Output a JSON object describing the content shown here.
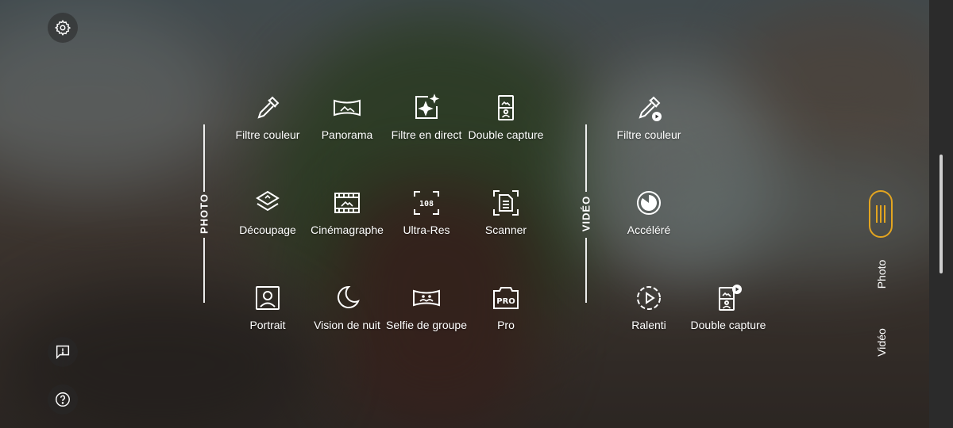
{
  "sections": {
    "photo": "PHOTO",
    "video": "VIDÉO"
  },
  "photo_modes": [
    {
      "label": "Filtre couleur",
      "icon": "eyedropper-icon"
    },
    {
      "label": "Panorama",
      "icon": "panorama-icon"
    },
    {
      "label": "Filtre en direct",
      "icon": "live-filter-icon"
    },
    {
      "label": "Double capture",
      "icon": "dual-capture-icon"
    },
    {
      "label": "Découpage",
      "icon": "layers-cutout-icon"
    },
    {
      "label": "Cinémagraphe",
      "icon": "film-icon"
    },
    {
      "label": "Ultra-Res",
      "icon": "ultra-res-108-icon"
    },
    {
      "label": "Scanner",
      "icon": "document-scan-icon"
    },
    {
      "label": "Portrait",
      "icon": "portrait-icon"
    },
    {
      "label": "Vision de nuit",
      "icon": "moon-icon"
    },
    {
      "label": "Selfie de groupe",
      "icon": "group-selfie-icon"
    },
    {
      "label": "Pro",
      "icon": "pro-icon"
    }
  ],
  "video_modes": [
    {
      "label": "Filtre couleur",
      "icon": "eyedropper-video-icon"
    },
    {
      "label": "Accéléré",
      "icon": "timelapse-icon"
    },
    {
      "label": "Ralenti",
      "icon": "slow-motion-icon"
    },
    {
      "label": "Double capture",
      "icon": "dual-capture-video-icon"
    }
  ],
  "side_tabs": {
    "photo": "Photo",
    "video": "Vidéo"
  },
  "accent_color": "#e3a520"
}
